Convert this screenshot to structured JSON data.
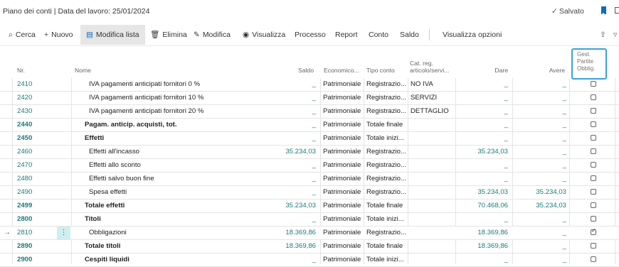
{
  "header": {
    "title": "Piano dei conti | Data del lavoro: 25/01/2024",
    "saved_label": "Salvato"
  },
  "toolbar": {
    "search": "Cerca",
    "new": "Nuovo",
    "edit_list": "Modifica lista",
    "delete": "Elimina",
    "edit": "Modifica",
    "view": "Visualizza",
    "process": "Processo",
    "report": "Report",
    "account": "Conto",
    "balance": "Saldo",
    "view_options": "Visualizza opzioni"
  },
  "columns": {
    "nr": "Nr.",
    "name": "Nome",
    "saldo": "Saldo",
    "economico": "Economico...",
    "tipo": "Tipo conto",
    "cat1": "Cat. reg.",
    "cat2": "articolo/servi...",
    "dare": "Dare",
    "avere": "Avere",
    "gest1": "Gest.",
    "gest2": "Partite",
    "gest3": "Obblig."
  },
  "rows": [
    {
      "nr": "2410",
      "name": "IVA pagamenti anticipati fornitori 0 %",
      "saldo": "_",
      "eco": "Patrimoniale",
      "tipo": "Registrazio...",
      "cat": "NO IVA",
      "dare": "_",
      "avere": "_",
      "checked": false,
      "bold": false,
      "indent": 2
    },
    {
      "nr": "2420",
      "name": "IVA pagamenti anticipati fornitori 10 %",
      "saldo": "_",
      "eco": "Patrimoniale",
      "tipo": "Registrazio...",
      "cat": "SERVIZI",
      "dare": "_",
      "avere": "_",
      "checked": false,
      "bold": false,
      "indent": 2
    },
    {
      "nr": "2430",
      "name": "IVA pagamenti anticipati fornitori 20 %",
      "saldo": "_",
      "eco": "Patrimoniale",
      "tipo": "Registrazio...",
      "cat": "DETTAGLIO",
      "dare": "_",
      "avere": "_",
      "checked": false,
      "bold": false,
      "indent": 2
    },
    {
      "nr": "2440",
      "name": "Pagam. anticip. acquisti, tot.",
      "saldo": "_",
      "eco": "Patrimoniale",
      "tipo": "Totale finale",
      "cat": "",
      "dare": "_",
      "avere": "_",
      "checked": false,
      "bold": true,
      "indent": 1
    },
    {
      "nr": "2450",
      "name": "Effetti",
      "saldo": "_",
      "eco": "Patrimoniale",
      "tipo": "Totale inizi...",
      "cat": "",
      "dare": "_",
      "avere": "_",
      "checked": false,
      "bold": true,
      "indent": 1
    },
    {
      "nr": "2460",
      "name": "Effetti all'incasso",
      "saldo": "35.234,03",
      "eco": "Patrimoniale",
      "tipo": "Registrazio...",
      "cat": "",
      "dare": "35.234,03",
      "avere": "_",
      "checked": false,
      "bold": false,
      "indent": 2
    },
    {
      "nr": "2470",
      "name": "Effetti allo sconto",
      "saldo": "_",
      "eco": "Patrimoniale",
      "tipo": "Registrazio...",
      "cat": "",
      "dare": "_",
      "avere": "_",
      "checked": false,
      "bold": false,
      "indent": 2
    },
    {
      "nr": "2480",
      "name": "Effetti salvo buon fine",
      "saldo": "_",
      "eco": "Patrimoniale",
      "tipo": "Registrazio...",
      "cat": "",
      "dare": "_",
      "avere": "_",
      "checked": false,
      "bold": false,
      "indent": 2
    },
    {
      "nr": "2490",
      "name": "Spesa effetti",
      "saldo": "_",
      "eco": "Patrimoniale",
      "tipo": "Registrazio...",
      "cat": "",
      "dare": "35.234,03",
      "avere": "35.234,03",
      "checked": false,
      "bold": false,
      "indent": 2
    },
    {
      "nr": "2499",
      "name": "Totale effetti",
      "saldo": "35.234,03",
      "eco": "Patrimoniale",
      "tipo": "Totale finale",
      "cat": "",
      "dare": "70.468,06",
      "avere": "35.234,03",
      "checked": false,
      "bold": true,
      "indent": 1
    },
    {
      "nr": "2800",
      "name": "Titoli",
      "saldo": "_",
      "eco": "Patrimoniale",
      "tipo": "Totale inizi...",
      "cat": "",
      "dare": "_",
      "avere": "_",
      "checked": false,
      "bold": true,
      "indent": 1
    },
    {
      "nr": "2810",
      "name": "Obbligazioni",
      "saldo": "18.369,86",
      "eco": "Patrimoniale",
      "tipo": "Registrazio...",
      "cat": "",
      "dare": "18.369,86",
      "avere": "_",
      "checked": true,
      "bold": false,
      "indent": 2,
      "selected": true
    },
    {
      "nr": "2890",
      "name": "Totale titoli",
      "saldo": "18.369,86",
      "eco": "Patrimoniale",
      "tipo": "Totale finale",
      "cat": "",
      "dare": "18.369,86",
      "avere": "_",
      "checked": false,
      "bold": true,
      "indent": 1
    },
    {
      "nr": "2900",
      "name": "Cespiti liquidi",
      "saldo": "_",
      "eco": "Patrimoniale",
      "tipo": "Totale inizi...",
      "cat": "",
      "dare": "_",
      "avere": "_",
      "checked": false,
      "bold": true,
      "indent": 1
    }
  ]
}
